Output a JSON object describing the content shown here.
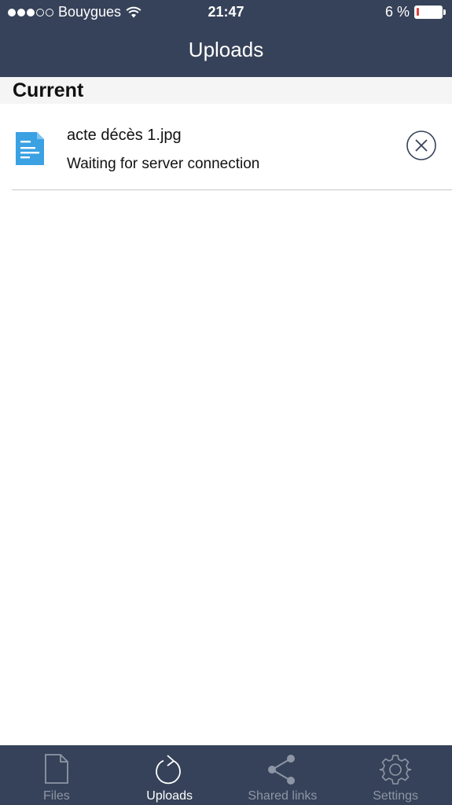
{
  "status_bar": {
    "carrier": "Bouygues",
    "time": "21:47",
    "battery": "6 %",
    "battery_level": 6,
    "signal_bars": 3,
    "icons": [
      "signal-dots-icon",
      "wifi-icon",
      "battery-icon"
    ]
  },
  "header": {
    "title": "Uploads"
  },
  "section": {
    "title": "Current"
  },
  "uploads": [
    {
      "filename": "acte décès 1.jpg",
      "status": "Waiting for server connection",
      "icon": "document-icon",
      "action_icon": "cancel-icon"
    }
  ],
  "tabs": [
    {
      "label": "Files",
      "icon": "file-icon",
      "active": false
    },
    {
      "label": "Uploads",
      "icon": "refresh-icon",
      "active": true
    },
    {
      "label": "Shared links",
      "icon": "share-icon",
      "active": false
    },
    {
      "label": "Settings",
      "icon": "gear-icon",
      "active": false
    }
  ],
  "colors": {
    "nav_bg": "#364259",
    "accent_doc": "#3aa1e3",
    "battery_low": "#e0403e",
    "tab_inactive": "#8e96a5"
  }
}
